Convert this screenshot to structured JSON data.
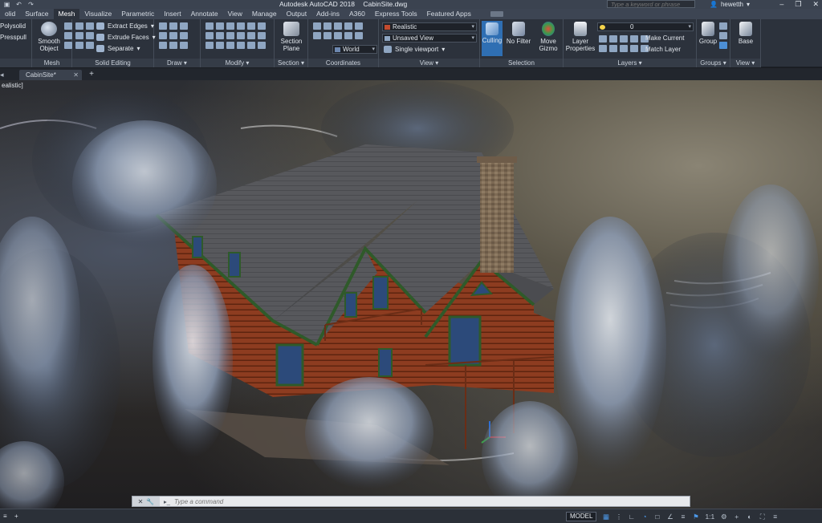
{
  "title_bar": {
    "app_name": "Autodesk AutoCAD 2018",
    "file_name": "CabinSite.dwg",
    "search_placeholder": "Type a keyword or phrase",
    "user_name": "hewetth"
  },
  "ribbon_tabs": [
    "olid",
    "Surface",
    "Mesh",
    "Visualize",
    "Parametric",
    "Insert",
    "Annotate",
    "View",
    "Manage",
    "Output",
    "Add-ins",
    "A360",
    "Express Tools",
    "Featured Apps"
  ],
  "ribbon": {
    "solid_editing_left": {
      "polysolid": "Polysolid",
      "presspull": "Presspull"
    },
    "mesh": {
      "title": "Mesh",
      "smooth_object": "Smooth Object"
    },
    "solid_editing": {
      "title": "Solid Editing",
      "extract_edges": "Extract Edges",
      "extrude_faces": "Extrude Faces",
      "separate": "Separate"
    },
    "draw": {
      "title": "Draw"
    },
    "modify": {
      "title": "Modify"
    },
    "section": {
      "title": "Section",
      "section_plane": "Section Plane"
    },
    "coordinates": {
      "title": "Coordinates",
      "world": "World"
    },
    "view": {
      "title": "View",
      "visual_style": "Realistic",
      "named_view": "Unsaved View",
      "viewport": "Single viewport"
    },
    "selection": {
      "title": "Selection",
      "culling": "Culling",
      "no_filter": "No Filter",
      "move_gizmo": "Move Gizmo"
    },
    "layers": {
      "title": "Layers",
      "layer_properties": "Layer Properties",
      "current_layer": "0",
      "make_current": "Make Current",
      "match_layer": "Match Layer"
    },
    "groups": {
      "title": "Groups",
      "group": "Group"
    },
    "view2": {
      "title": "View",
      "base": "Base"
    }
  },
  "doc_tabs": {
    "active": "CabinSite*",
    "new_tab": "+"
  },
  "viewport": {
    "label": "ealistic]"
  },
  "command_line": {
    "placeholder": "Type a command"
  },
  "status_bar": {
    "model_label": "MODEL",
    "scale": "1:1"
  },
  "colors": {
    "accent": "#2f6fb3",
    "ribbon_bg": "#2c323c",
    "log_wall": "#8a3a20",
    "trim": "#2f5a2a",
    "roof": "#56575b"
  }
}
